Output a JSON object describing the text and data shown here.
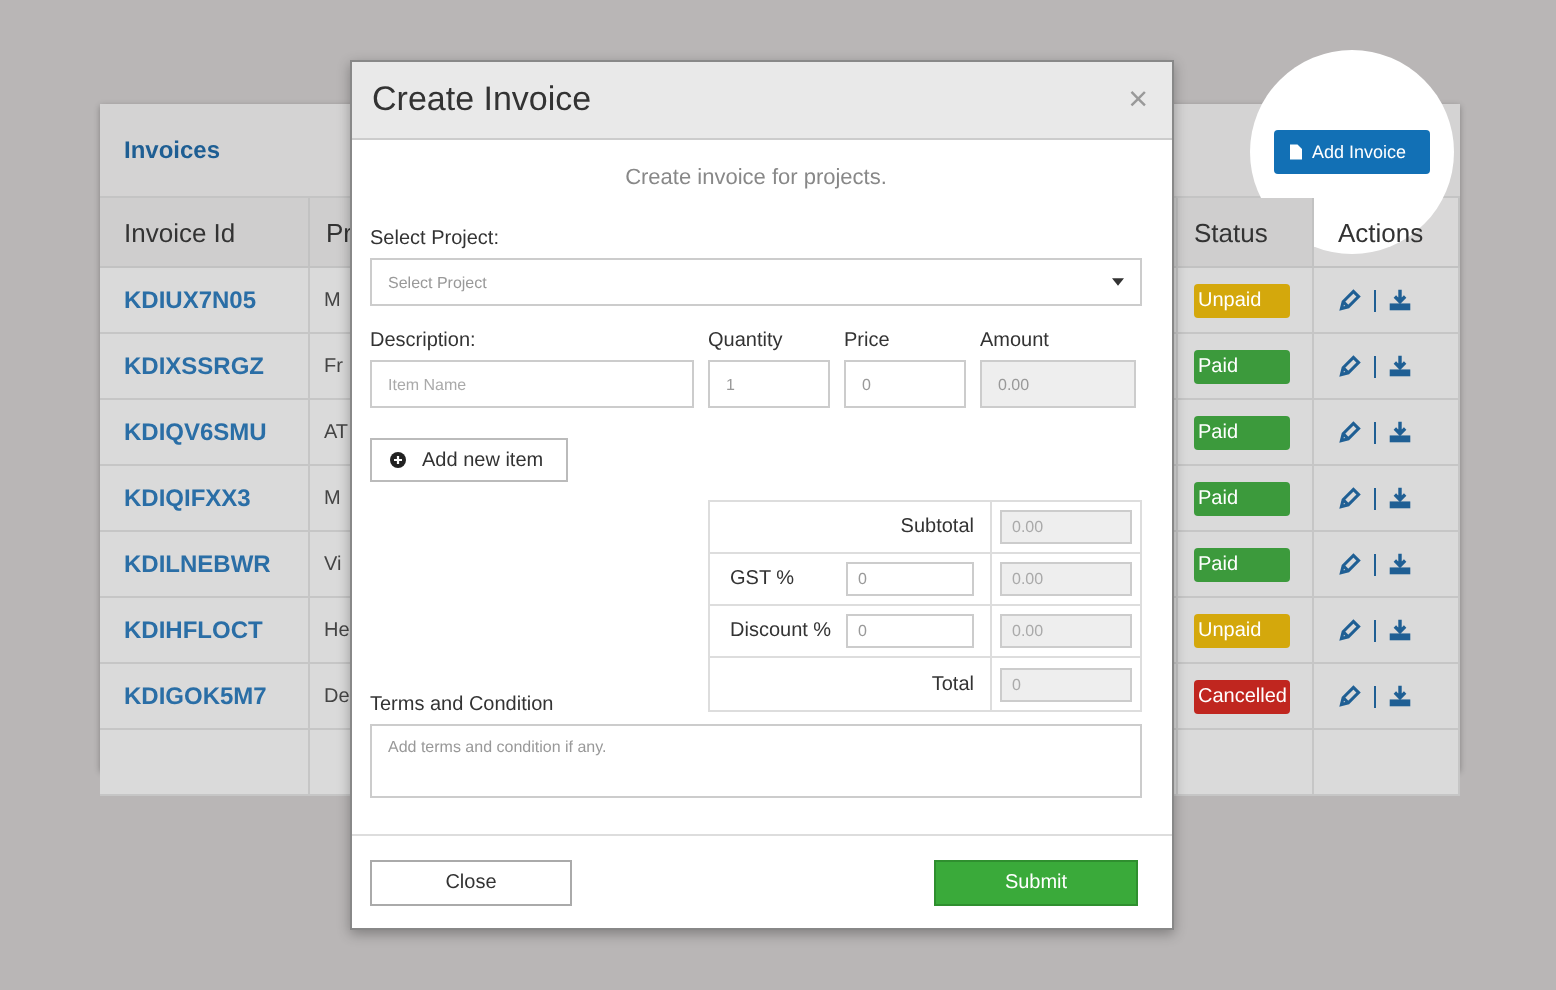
{
  "card": {
    "title": "Invoices",
    "add_button": "Add Invoice"
  },
  "table": {
    "columns": [
      "Invoice Id",
      "Pr",
      "Status",
      "Actions"
    ],
    "rows": [
      {
        "id": "KDIUX7N05",
        "project": "M",
        "status": "Unpaid",
        "color": "#d4a80c"
      },
      {
        "id": "KDIXSSRGZ",
        "project": "Fr",
        "status": "Paid",
        "color": "#3c9a3c"
      },
      {
        "id": "KDIQV6SMU",
        "project": "AT",
        "status": "Paid",
        "color": "#3c9a3c"
      },
      {
        "id": "KDIQIFXX3",
        "project": "M",
        "status": "Paid",
        "color": "#3c9a3c"
      },
      {
        "id": "KDILNEBWR",
        "project": "Vi",
        "status": "Paid",
        "color": "#3c9a3c"
      },
      {
        "id": "KDIHFLOCT",
        "project": "He",
        "status": "Unpaid",
        "color": "#d4a80c"
      },
      {
        "id": "KDIGOK5M7",
        "project": "De",
        "status": "Cancelled",
        "color": "#c0261f"
      }
    ]
  },
  "modal": {
    "title": "Create Invoice",
    "close_icon": "×",
    "subtitle": "Create invoice for projects.",
    "project_label": "Select Project:",
    "project_placeholder": "Select Project",
    "item_labels": [
      "Description:",
      "Quantity",
      "Price",
      "Amount"
    ],
    "item": {
      "description_placeholder": "Item Name",
      "quantity": "1",
      "price": "0",
      "amount": "0.00"
    },
    "add_item_button": "Add new item",
    "totals": [
      {
        "label": "Subtotal",
        "value": "0.00"
      },
      {
        "label": "GST %",
        "input": "0",
        "value": "0.00"
      },
      {
        "label": "Discount %",
        "input": "0",
        "value": "0.00"
      },
      {
        "label": "Total",
        "value": "0"
      }
    ],
    "terms_label": "Terms and Condition",
    "terms_placeholder": "Add terms and condition if any.",
    "close_button": "Close",
    "submit_button": "Submit"
  }
}
